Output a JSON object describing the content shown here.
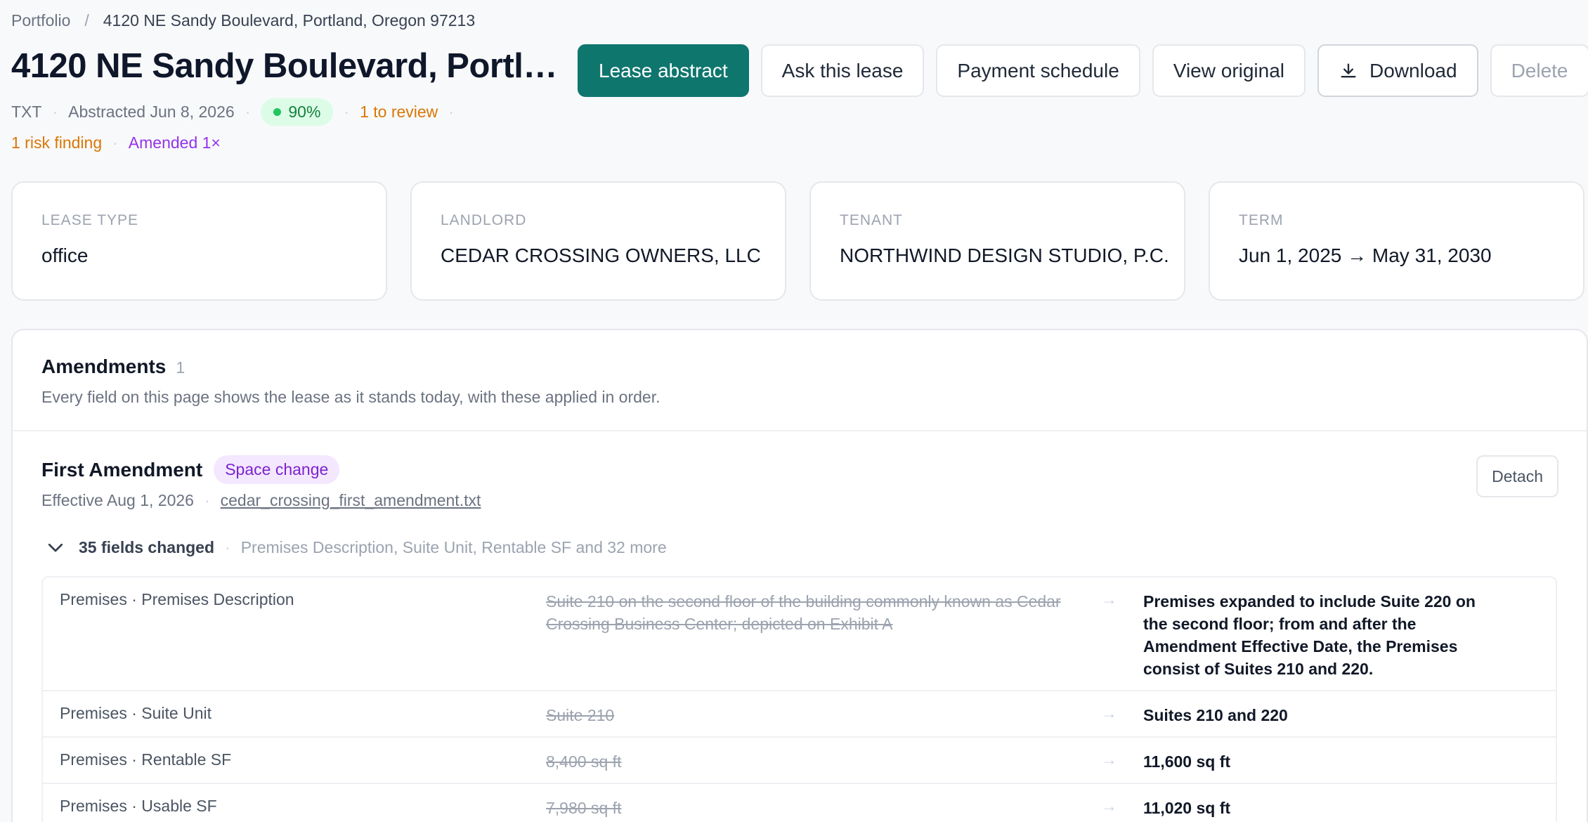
{
  "breadcrumb": {
    "root": "Portfolio",
    "separator": "/",
    "current": "4120 NE Sandy Boulevard, Portland, Oregon 97213"
  },
  "header": {
    "title": "4120 NE Sandy Boulevard, Portland, Oregon 97213",
    "actions": {
      "lease_abstract": "Lease abstract",
      "ask_lease": "Ask this lease",
      "payment_schedule": "Payment schedule",
      "view_original": "View original",
      "download": "Download",
      "delete": "Delete"
    }
  },
  "meta": {
    "format": "TXT",
    "abstracted": "Abstracted Jun 8, 2026",
    "confidence": "90%",
    "to_review": "1 to review",
    "risk": "1 risk finding",
    "amended": "Amended 1×"
  },
  "summary": [
    {
      "label": "LEASE TYPE",
      "value": "office"
    },
    {
      "label": "LANDLORD",
      "value": "CEDAR CROSSING OWNERS, LLC"
    },
    {
      "label": "TENANT",
      "value": "NORTHWIND DESIGN STUDIO, P.C."
    },
    {
      "label": "TERM",
      "value": "Jun 1, 2025 → May 31, 2030"
    }
  ],
  "amendments": {
    "title": "Amendments",
    "count": "1",
    "description": "Every field on this page shows the lease as it stands today, with these applied in order.",
    "items": [
      {
        "name": "First Amendment",
        "badge": "Space change",
        "effective": "Effective Aug 1, 2026",
        "file": "cedar_crossing_first_amendment.txt",
        "detach_label": "Detach",
        "changes_count": "35 fields changed",
        "changes_summary": "Premises Description, Suite Unit, Rentable SF and 32 more",
        "changes": [
          {
            "field": "Premises · Premises Description",
            "old": "Suite 210 on the second floor of the building commonly known as Cedar Crossing Business Center; depicted on Exhibit A",
            "arrow": "→",
            "new": "Premises expanded to include Suite 220 on the second floor; from and after the Amendment Effective Date, the Premises consist of Suites 210 and 220."
          },
          {
            "field": "Premises · Suite Unit",
            "old": "Suite 210",
            "arrow": "→",
            "new": "Suites 210 and 220"
          },
          {
            "field": "Premises · Rentable SF",
            "old": "8,400 sq ft",
            "arrow": "→",
            "new": "11,600 sq ft"
          },
          {
            "field": "Premises · Usable SF",
            "old": "7,980 sq ft",
            "arrow": "→",
            "new": "11,020 sq ft"
          }
        ]
      }
    ]
  },
  "colors": {
    "primary": "#0f766e",
    "confidence_bg": "#dcfce7",
    "confidence_text": "#15803d",
    "warning": "#d97706",
    "amended": "#9333ea"
  }
}
